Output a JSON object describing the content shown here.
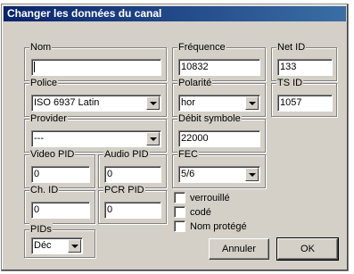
{
  "dialog": {
    "title": "Changer les données du canal"
  },
  "fields": {
    "nom": {
      "label": "Nom",
      "value": ""
    },
    "frequence": {
      "label": "Fréquence",
      "value": "10832"
    },
    "net_id": {
      "label": "Net ID",
      "value": "133"
    },
    "police": {
      "label": "Police",
      "value": "ISO 6937 Latin"
    },
    "polarite": {
      "label": "Polarité",
      "value": "hor"
    },
    "ts_id": {
      "label": "TS ID",
      "value": "1057"
    },
    "provider": {
      "label": "Provider",
      "value": "---"
    },
    "debit_symbole": {
      "label": "Débit symbole",
      "value": "22000"
    },
    "video_pid": {
      "label": "Video PID",
      "value": "0"
    },
    "audio_pid": {
      "label": "Audio PID",
      "value": "0"
    },
    "fec": {
      "label": "FEC",
      "value": "5/6"
    },
    "ch_id": {
      "label": "Ch. ID",
      "value": "0"
    },
    "pcr_pid": {
      "label": "PCR PID",
      "value": "0"
    },
    "pids": {
      "label": "PIDs",
      "value": "Déc"
    }
  },
  "checkboxes": [
    {
      "label": "verrouillé",
      "checked": false
    },
    {
      "label": "codé",
      "checked": false
    },
    {
      "label": "Nom protégé",
      "checked": false
    }
  ],
  "buttons": {
    "cancel": "Annuler",
    "ok": "OK"
  }
}
